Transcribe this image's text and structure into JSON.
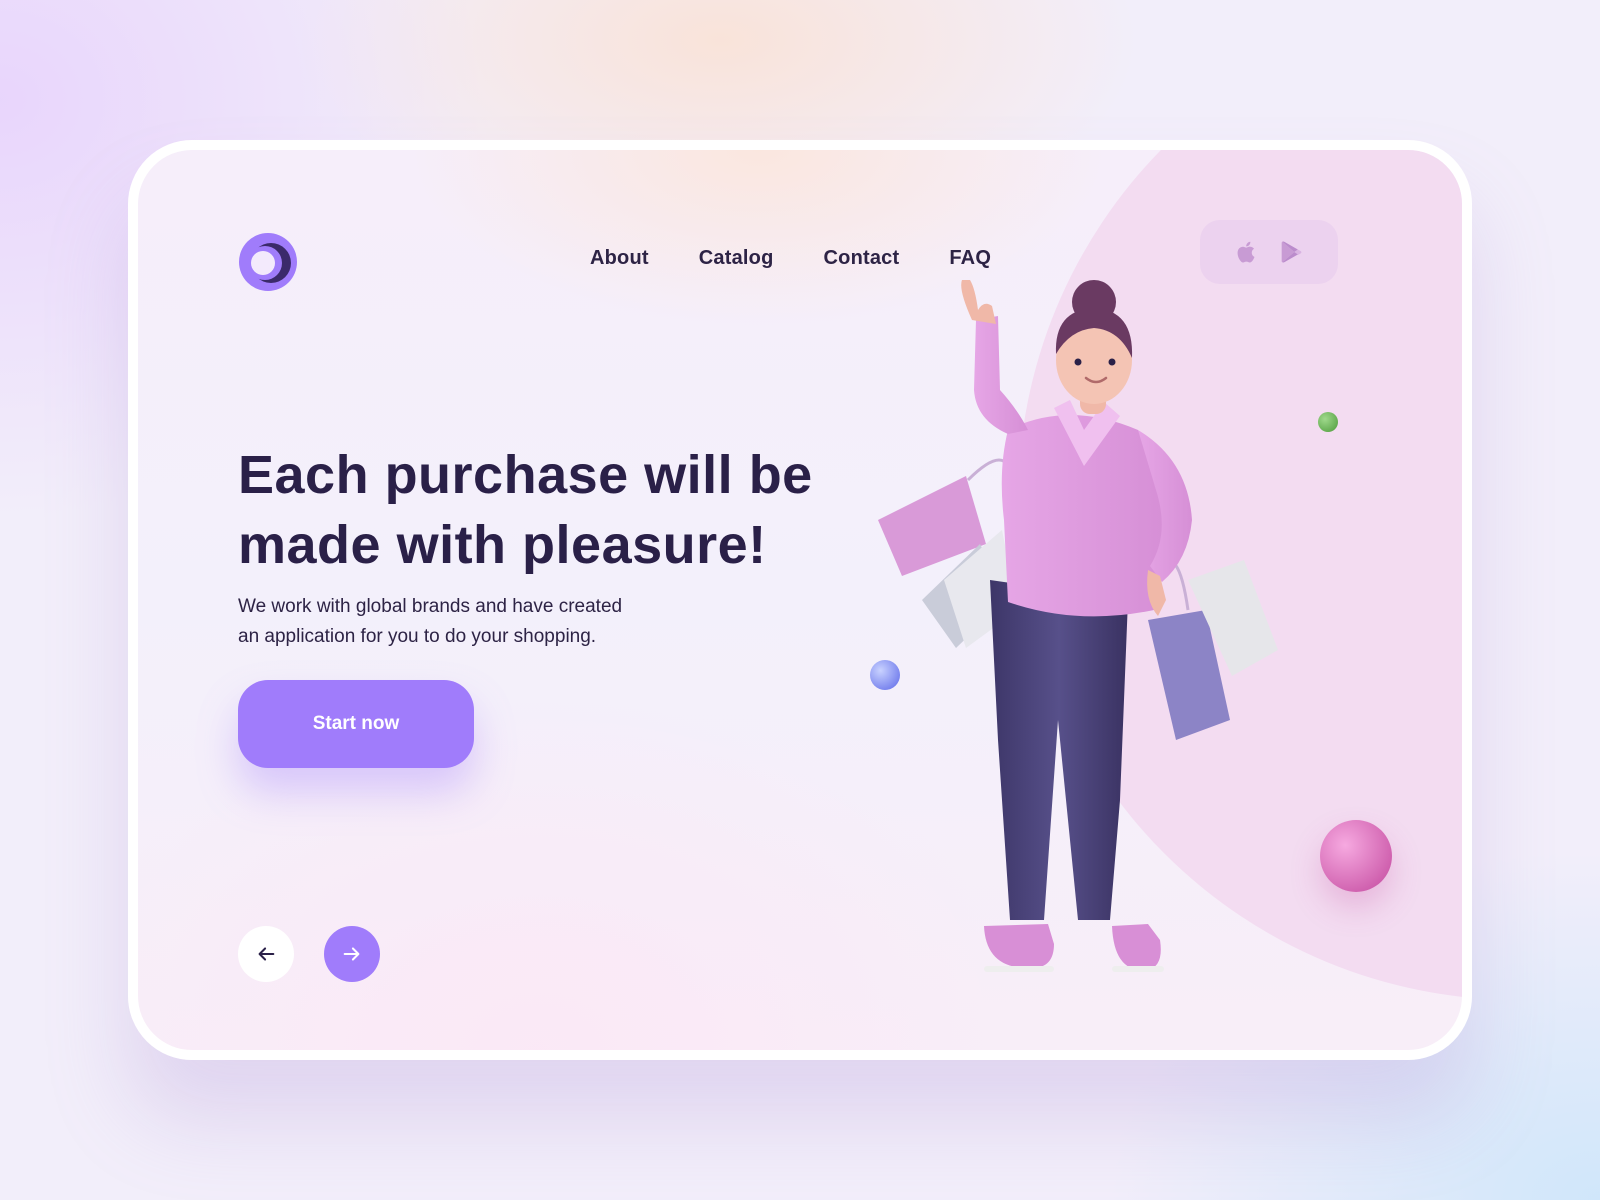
{
  "nav": {
    "items": [
      {
        "label": "About"
      },
      {
        "label": "Catalog"
      },
      {
        "label": "Contact"
      },
      {
        "label": "FAQ"
      }
    ]
  },
  "store_icons": [
    "apple-icon",
    "google-play-icon"
  ],
  "hero": {
    "headline_line1": "Each purchase will be",
    "headline_line2": "made with pleasure!",
    "subtext_line1": "We work with global brands and have created",
    "subtext_line2": "an application for you to do your shopping.",
    "cta_label": "Start now"
  },
  "carousel": {
    "prev_icon": "arrow-left-icon",
    "next_icon": "arrow-right-icon"
  },
  "colors": {
    "accent": "#a07cfb",
    "text_dark": "#2a2048",
    "pink_arc": "#f3dcf1",
    "store_box": "#ecd2ef"
  }
}
